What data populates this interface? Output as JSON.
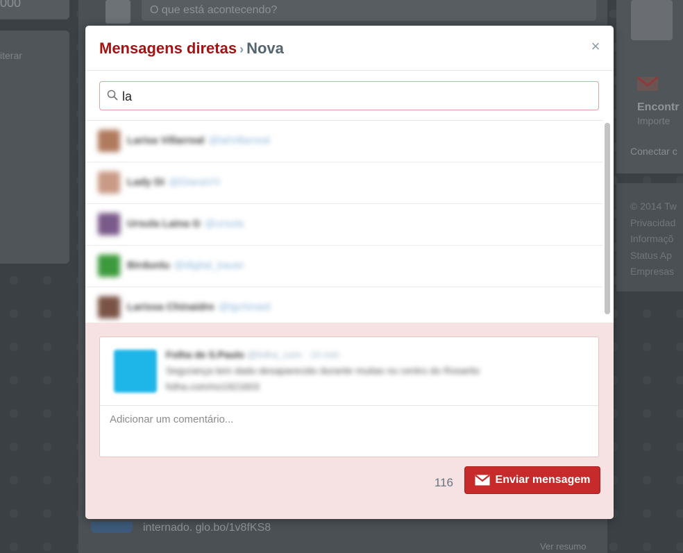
{
  "background": {
    "left_number": "000",
    "left_link": "iterar",
    "compose_placeholder": "O que está acontecendo?",
    "right_title": "Encontr",
    "right_subtitle": "Importe",
    "right_link": "Conectar c",
    "right_footer": [
      "© 2014 Tw",
      "Privacidad",
      "Informaçõ",
      "Status  Ap",
      "Empresas"
    ],
    "tweet_text": "internado. glo.bo/1v8fKS8",
    "resumo": "Ver resumo"
  },
  "modal": {
    "title": "Mensagens diretas",
    "separator": "›",
    "crumb": "Nova",
    "close_label": "×",
    "search": {
      "value": "la"
    },
    "results": [
      {
        "name": "Larisa Villarreal",
        "handle": "@lalVillarreal",
        "avatar_color": "#b07a5e"
      },
      {
        "name": "Lady Di",
        "handle": "@DianaVV",
        "avatar_color": "#c99a86"
      },
      {
        "name": "Ursula Laina G",
        "handle": "@ursula",
        "avatar_color": "#7a5a8a"
      },
      {
        "name": "Birdunlu",
        "handle": "@digital_bauer",
        "avatar_color": "#3c9a3c"
      },
      {
        "name": "Larissa Chinaidre",
        "handle": "@lgchinaid",
        "avatar_color": "#7b5346"
      }
    ],
    "tweet": {
      "author": "Folha de S.Paulo",
      "meta": "@folha_com · 10 min",
      "line1": "Segurança tem dado desaparecido durante muitas no centro do Rosarito",
      "line2": "folha.com/no1921603"
    },
    "comment_placeholder": "Adicionar um comentário...",
    "char_count": "116",
    "send_label": "Enviar mensagem"
  }
}
